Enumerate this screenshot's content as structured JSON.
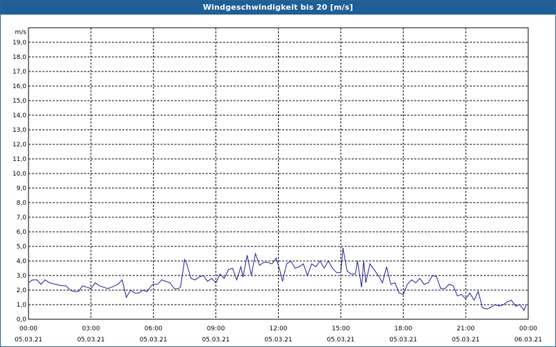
{
  "window": {
    "title": "Windgeschwindigkeit bis 20 [m/s]"
  },
  "colors": {
    "title_bar": "#1f5f95",
    "series": "#1a1a99",
    "grid": "#000000"
  },
  "chart_data": {
    "type": "line",
    "title": "Windgeschwindigkeit bis 20 [m/s]",
    "ylabel": "m/s",
    "xlabel": "",
    "ylim": [
      0,
      20
    ],
    "xlim_hours": [
      0,
      24
    ],
    "y_ticks": [
      "0,0",
      "1,0",
      "2,0",
      "3,0",
      "4,0",
      "5,0",
      "6,0",
      "7,0",
      "8,0",
      "9,0",
      "10,0",
      "11,0",
      "12,0",
      "13,0",
      "14,0",
      "15,0",
      "16,0",
      "17,0",
      "18,0",
      "19,0"
    ],
    "x_ticks": [
      {
        "time": "00:00",
        "date": "05.03.21"
      },
      {
        "time": "03:00",
        "date": "05.03.21"
      },
      {
        "time": "06:00",
        "date": "05.03.21"
      },
      {
        "time": "09:00",
        "date": "05.03.21"
      },
      {
        "time": "12:00",
        "date": "05.03.21"
      },
      {
        "time": "15:00",
        "date": "05.03.21"
      },
      {
        "time": "18:00",
        "date": "05.03.21"
      },
      {
        "time": "21:00",
        "date": "05.03.21"
      },
      {
        "time": "00:00",
        "date": "06.03.21"
      }
    ],
    "grid": true,
    "series": [
      {
        "name": "",
        "points": [
          [
            0.0,
            2.5
          ],
          [
            0.2,
            2.7
          ],
          [
            0.4,
            2.7
          ],
          [
            0.6,
            2.4
          ],
          [
            0.8,
            2.7
          ],
          [
            1.0,
            2.5
          ],
          [
            1.3,
            2.4
          ],
          [
            1.6,
            2.3
          ],
          [
            1.8,
            2.3
          ],
          [
            2.0,
            2.0
          ],
          [
            2.2,
            1.9
          ],
          [
            2.4,
            1.9
          ],
          [
            2.6,
            2.3
          ],
          [
            2.8,
            2.2
          ],
          [
            3.0,
            2.1
          ],
          [
            3.2,
            2.5
          ],
          [
            3.4,
            2.3
          ],
          [
            3.6,
            2.2
          ],
          [
            3.8,
            2.1
          ],
          [
            4.0,
            2.2
          ],
          [
            4.3,
            2.4
          ],
          [
            4.5,
            2.7
          ],
          [
            4.7,
            1.5
          ],
          [
            4.9,
            2.0
          ],
          [
            5.1,
            1.8
          ],
          [
            5.3,
            1.8
          ],
          [
            5.5,
            2.0
          ],
          [
            5.7,
            1.9
          ],
          [
            5.9,
            2.3
          ],
          [
            6.0,
            2.4
          ],
          [
            6.2,
            2.4
          ],
          [
            6.4,
            2.7
          ],
          [
            6.6,
            2.6
          ],
          [
            6.8,
            2.5
          ],
          [
            7.0,
            2.1
          ],
          [
            7.2,
            2.1
          ],
          [
            7.3,
            2.2
          ],
          [
            7.5,
            4.1
          ],
          [
            7.6,
            3.8
          ],
          [
            7.8,
            2.8
          ],
          [
            8.0,
            2.7
          ],
          [
            8.2,
            2.9
          ],
          [
            8.4,
            3.0
          ],
          [
            8.6,
            2.6
          ],
          [
            8.8,
            2.8
          ],
          [
            9.0,
            2.5
          ],
          [
            9.2,
            3.1
          ],
          [
            9.4,
            2.8
          ],
          [
            9.6,
            3.4
          ],
          [
            9.8,
            3.5
          ],
          [
            10.0,
            2.7
          ],
          [
            10.2,
            3.6
          ],
          [
            10.3,
            2.9
          ],
          [
            10.5,
            4.4
          ],
          [
            10.7,
            3.0
          ],
          [
            10.9,
            4.5
          ],
          [
            11.1,
            3.7
          ],
          [
            11.3,
            3.9
          ],
          [
            11.5,
            3.9
          ],
          [
            11.7,
            3.8
          ],
          [
            11.9,
            4.2
          ],
          [
            12.1,
            3.2
          ],
          [
            12.2,
            2.6
          ],
          [
            12.4,
            3.8
          ],
          [
            12.6,
            4.0
          ],
          [
            12.8,
            3.5
          ],
          [
            13.0,
            3.6
          ],
          [
            13.2,
            3.8
          ],
          [
            13.4,
            3.0
          ],
          [
            13.6,
            3.8
          ],
          [
            13.8,
            3.6
          ],
          [
            14.0,
            4.0
          ],
          [
            14.2,
            3.5
          ],
          [
            14.4,
            4.0
          ],
          [
            14.6,
            3.5
          ],
          [
            14.8,
            3.2
          ],
          [
            15.0,
            3.2
          ],
          [
            15.1,
            4.9
          ],
          [
            15.3,
            3.3
          ],
          [
            15.5,
            3.1
          ],
          [
            15.7,
            3.1
          ],
          [
            15.8,
            4.0
          ],
          [
            16.0,
            2.2
          ],
          [
            16.1,
            4.0
          ],
          [
            16.2,
            2.5
          ],
          [
            16.4,
            3.8
          ],
          [
            16.6,
            3.4
          ],
          [
            16.8,
            3.0
          ],
          [
            17.0,
            2.5
          ],
          [
            17.2,
            3.6
          ],
          [
            17.4,
            2.4
          ],
          [
            17.6,
            2.5
          ],
          [
            17.8,
            1.8
          ],
          [
            18.0,
            1.7
          ],
          [
            18.2,
            2.4
          ],
          [
            18.4,
            2.7
          ],
          [
            18.6,
            2.5
          ],
          [
            18.8,
            2.8
          ],
          [
            19.0,
            2.4
          ],
          [
            19.2,
            2.5
          ],
          [
            19.4,
            3.0
          ],
          [
            19.6,
            2.9
          ],
          [
            19.8,
            2.1
          ],
          [
            20.0,
            2.1
          ],
          [
            20.2,
            2.4
          ],
          [
            20.4,
            2.3
          ],
          [
            20.6,
            1.6
          ],
          [
            20.8,
            1.7
          ],
          [
            21.0,
            1.4
          ],
          [
            21.2,
            1.8
          ],
          [
            21.4,
            1.3
          ],
          [
            21.6,
            1.9
          ],
          [
            21.8,
            0.8
          ],
          [
            22.0,
            0.7
          ],
          [
            22.2,
            0.8
          ],
          [
            22.4,
            1.0
          ],
          [
            22.6,
            0.9
          ],
          [
            22.8,
            1.0
          ],
          [
            23.0,
            1.2
          ],
          [
            23.2,
            1.3
          ],
          [
            23.4,
            0.9
          ],
          [
            23.6,
            1.0
          ],
          [
            23.8,
            0.6
          ],
          [
            23.9,
            1.0
          ],
          [
            24.0,
            1.0
          ]
        ]
      }
    ]
  }
}
